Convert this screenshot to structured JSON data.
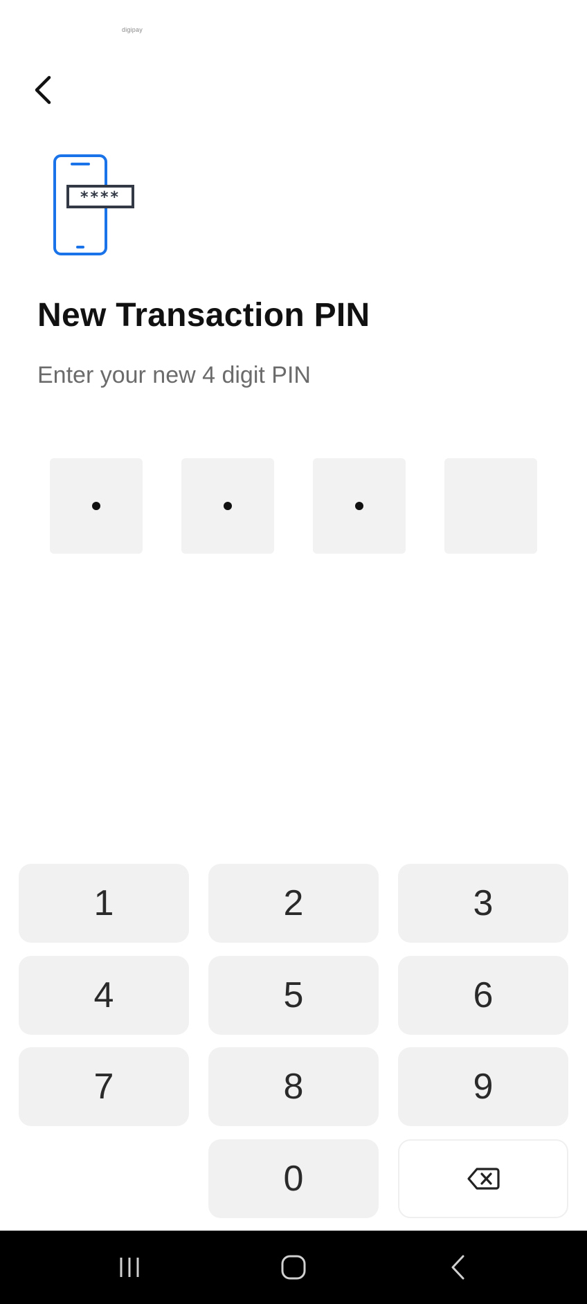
{
  "status": {
    "logo_text": "digipay"
  },
  "header": {
    "back_icon": "chevron-left-icon"
  },
  "illustration": {
    "icon": "phone-pin-icon",
    "masked_pin": "****",
    "accent_color": "#1a73e8"
  },
  "title": "New Transaction PIN",
  "subtitle": "Enter your new 4 digit PIN",
  "pin": {
    "length": 4,
    "entered": 3
  },
  "keypad": {
    "keys": [
      "1",
      "2",
      "3",
      "4",
      "5",
      "6",
      "7",
      "8",
      "9",
      "0"
    ],
    "delete_icon": "backspace-icon"
  },
  "navbar": {
    "recents_icon": "recents-icon",
    "home_icon": "home-icon",
    "back_icon": "back-icon"
  }
}
